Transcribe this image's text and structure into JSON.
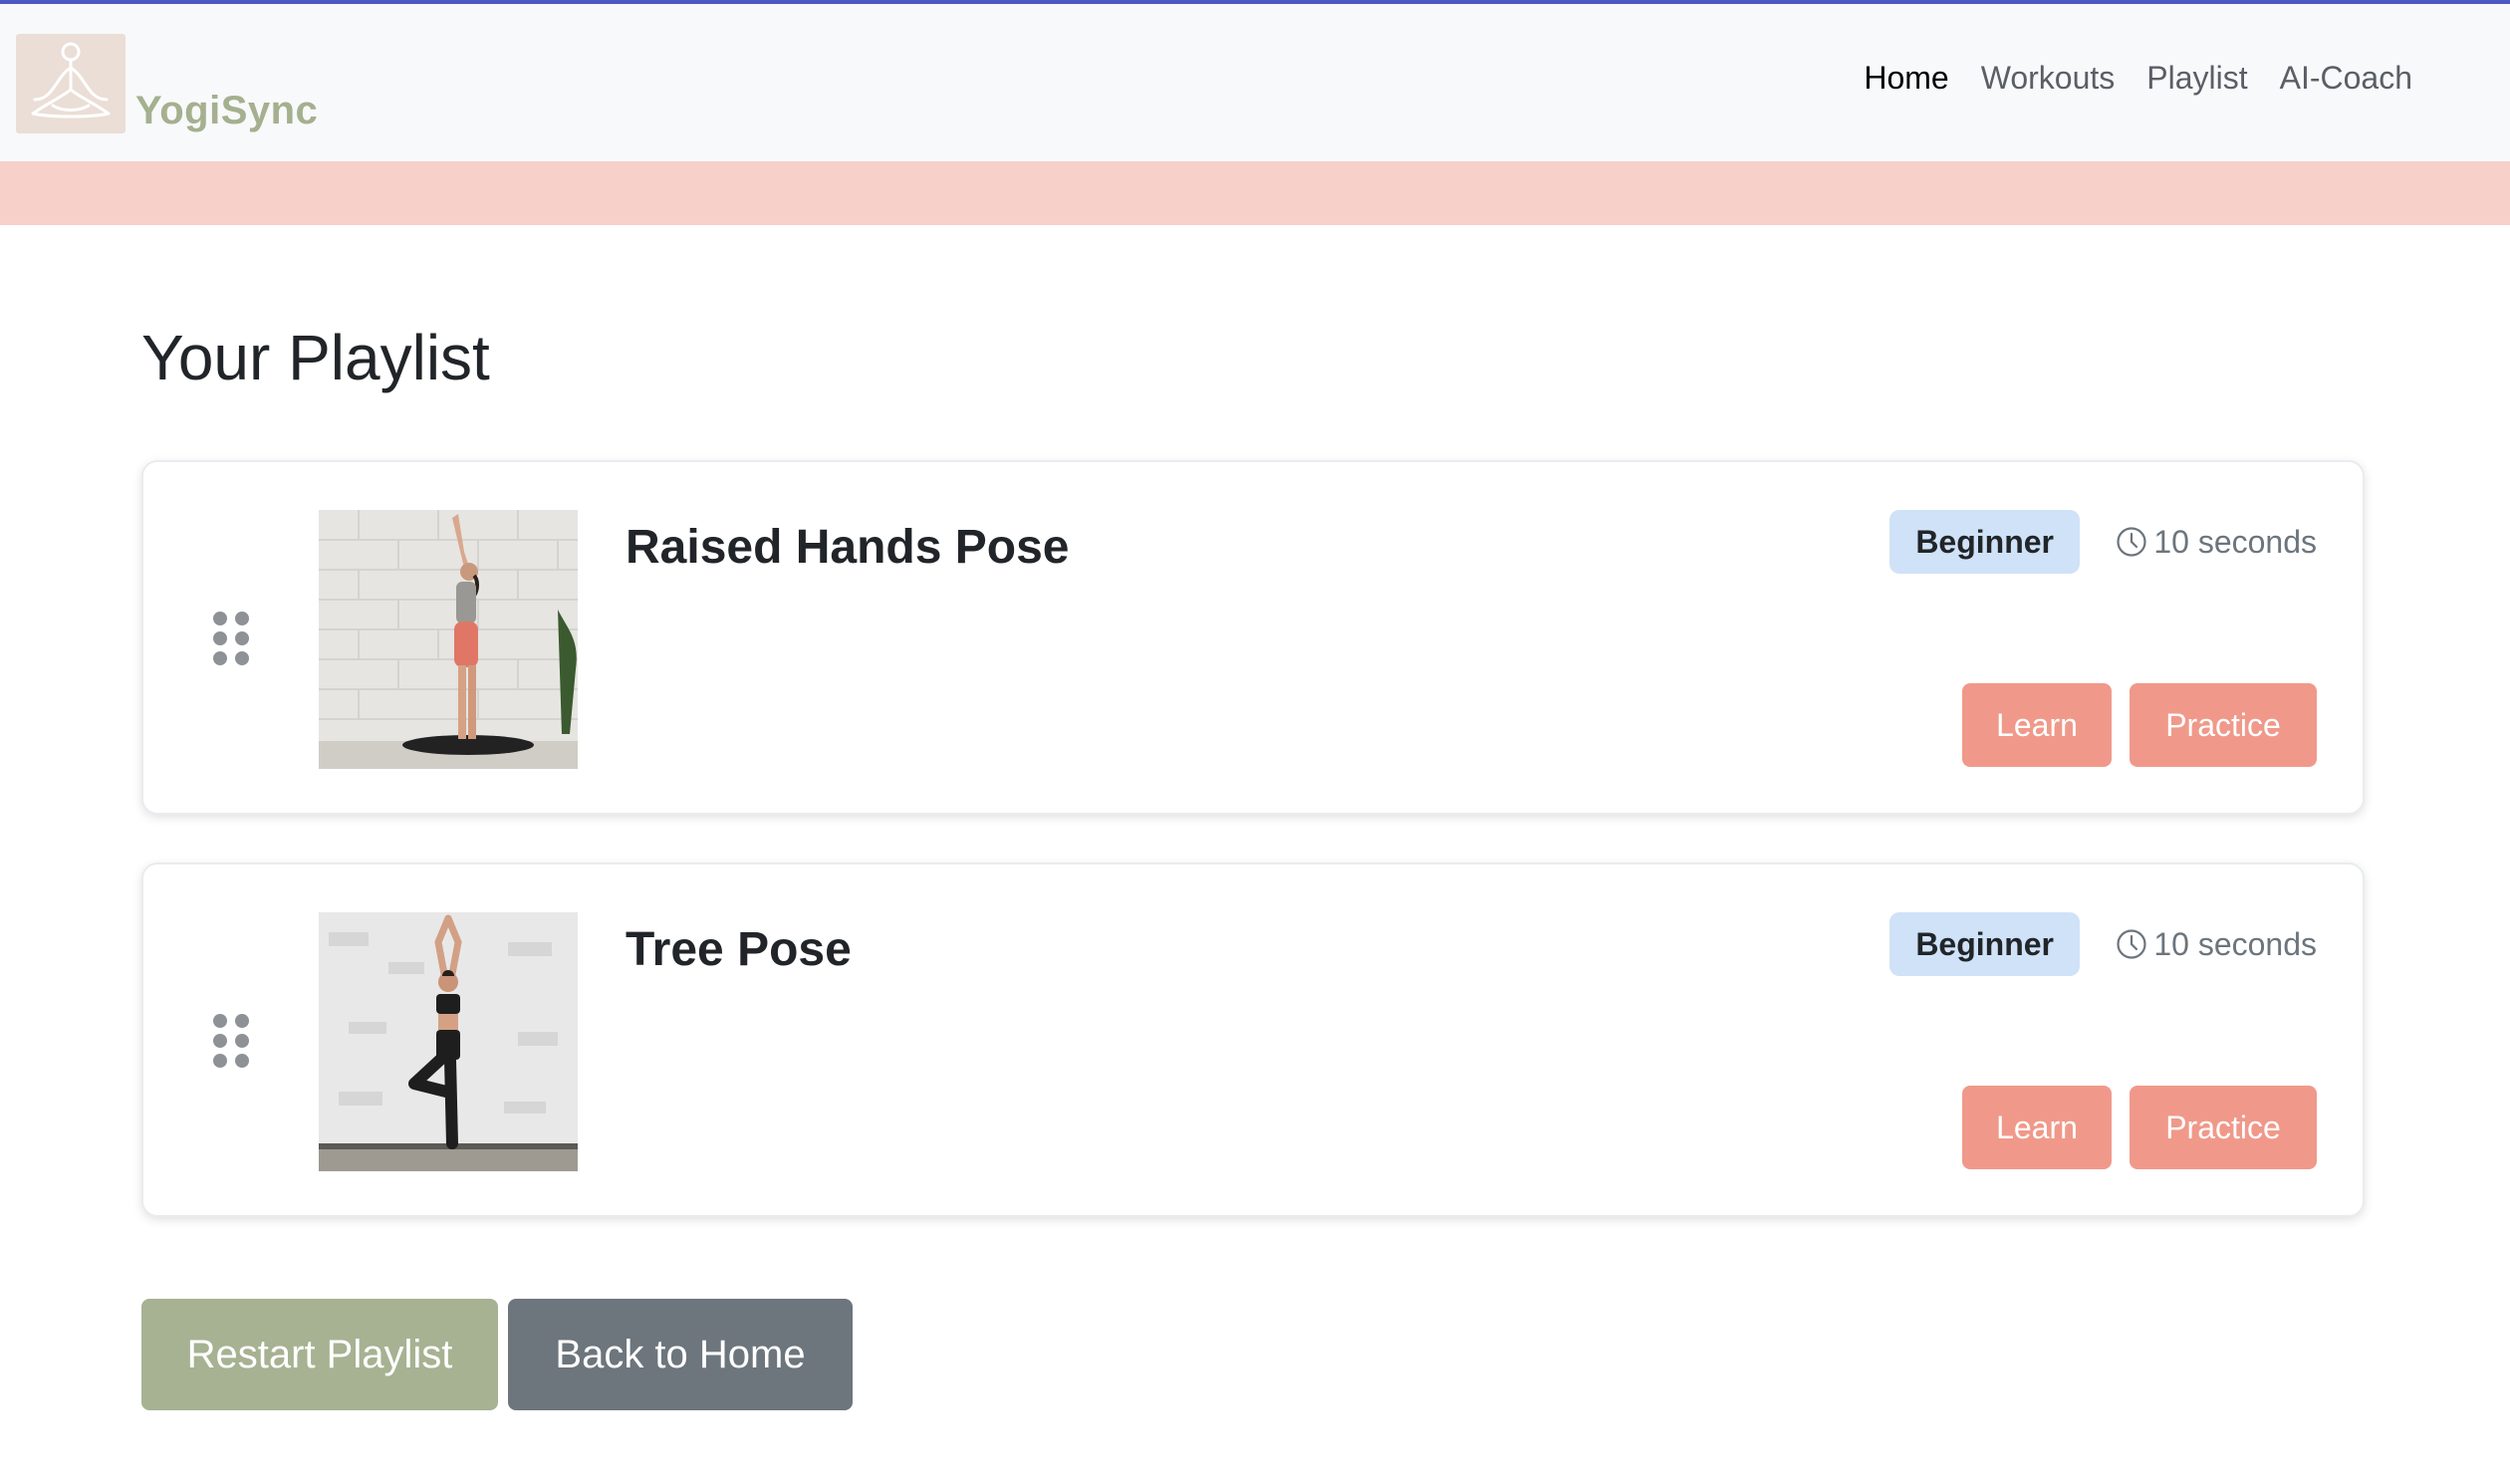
{
  "brand": {
    "name": "YogiSync",
    "logo_icon": "meditation-logo-icon"
  },
  "nav": {
    "links": [
      {
        "label": "Home",
        "active": true
      },
      {
        "label": "Workouts",
        "active": false
      },
      {
        "label": "Playlist",
        "active": false
      },
      {
        "label": "AI-Coach",
        "active": false
      }
    ]
  },
  "page": {
    "title": "Your Playlist"
  },
  "playlist": [
    {
      "name": "Raised Hands Pose",
      "level": "Beginner",
      "duration": "10 seconds",
      "learn_label": "Learn",
      "practice_label": "Practice",
      "image_icon": "raised-hands-pose-photo"
    },
    {
      "name": "Tree Pose",
      "level": "Beginner",
      "duration": "10 seconds",
      "learn_label": "Learn",
      "practice_label": "Practice",
      "image_icon": "tree-pose-photo"
    }
  ],
  "actions": {
    "restart_label": "Restart Playlist",
    "back_label": "Back to Home"
  },
  "colors": {
    "accent_pink": "#f0998a",
    "brand_green": "#a4b08f",
    "badge_blue": "#cfe2f7",
    "restart_green": "#a6b292",
    "back_gray": "#6d757d",
    "band_pink": "#f7d0c9"
  }
}
